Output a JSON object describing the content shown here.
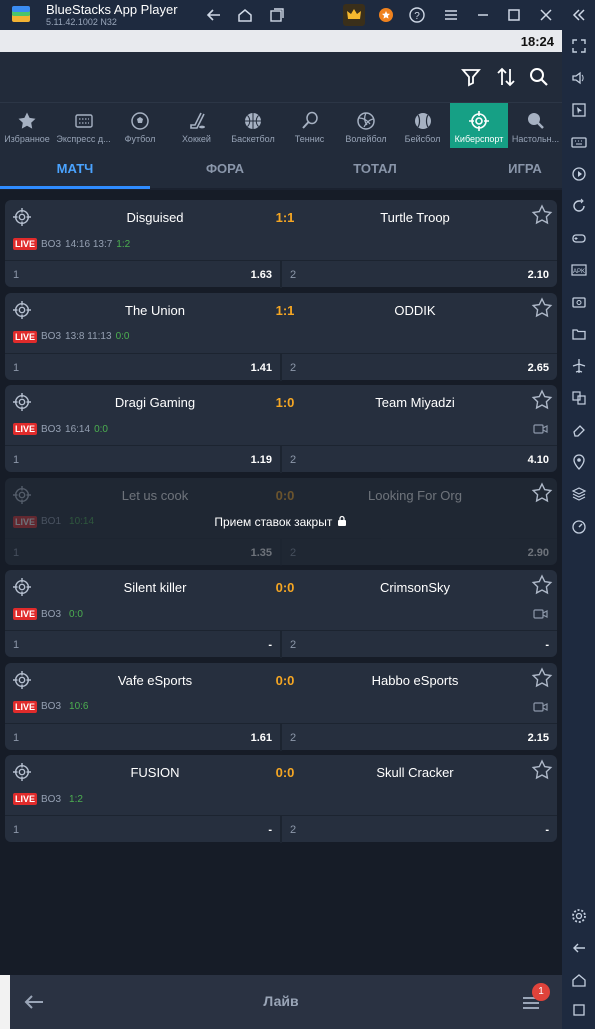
{
  "window": {
    "title": "BlueStacks App Player",
    "version": "5.11.42.1002 N32"
  },
  "status": {
    "time": "18:24"
  },
  "sports": [
    {
      "label": "Избранное",
      "icon": "star-icon"
    },
    {
      "label": "Экспресс д...",
      "icon": "express-icon"
    },
    {
      "label": "Футбол",
      "icon": "soccer-ball-icon"
    },
    {
      "label": "Хоккей",
      "icon": "hockey-stick-icon"
    },
    {
      "label": "Баскетбол",
      "icon": "basketball-icon"
    },
    {
      "label": "Теннис",
      "icon": "tennis-racket-icon"
    },
    {
      "label": "Волейбол",
      "icon": "volleyball-icon"
    },
    {
      "label": "Бейсбол",
      "icon": "baseball-icon"
    },
    {
      "label": "Киберспорт",
      "icon": "crosshair-icon",
      "active": true
    },
    {
      "label": "Настольн...",
      "icon": "table-tennis-icon"
    }
  ],
  "tabs": [
    "МАТЧ",
    "ФОРА",
    "ТОТАЛ",
    "ИГРА"
  ],
  "live_label": "LIVE",
  "matches": [
    {
      "team1": "Disguised",
      "team2": "Turtle Troop",
      "score": "1:1",
      "format": "BO3",
      "time": "14:16 13:7",
      "extra": "1:2",
      "odd1_label": "1",
      "odd1": "1.63",
      "odd2_label": "2",
      "odd2": "2.10",
      "video": false
    },
    {
      "team1": "The Union",
      "team2": "ODDIK",
      "score": "1:1",
      "format": "BO3",
      "time": "13:8 11:13",
      "extra": "0:0",
      "odd1_label": "1",
      "odd1": "1.41",
      "odd2_label": "2",
      "odd2": "2.65",
      "video": false
    },
    {
      "team1": "Dragi Gaming",
      "team2": "Team Miyadzi",
      "score": "1:0",
      "format": "BO3",
      "time": "16:14",
      "extra": "0:0",
      "odd1_label": "1",
      "odd1": "1.19",
      "odd2_label": "2",
      "odd2": "4.10",
      "video": true
    },
    {
      "team1": "Let us cook",
      "team2": "Looking For Org",
      "score": "0:0",
      "format": "BO1",
      "time": "",
      "extra": "10:14",
      "odd1_label": "1",
      "odd1": "1.35",
      "odd2_label": "2",
      "odd2": "2.90",
      "video": false,
      "closed": "Прием ставок закрыт"
    },
    {
      "team1": "Silent killer",
      "team2": "CrimsonSky",
      "score": "0:0",
      "format": "BO3",
      "time": "",
      "extra": "0:0",
      "odd1_label": "1",
      "odd1": "-",
      "odd2_label": "2",
      "odd2": "-",
      "video": true
    },
    {
      "team1": "Vafe eSports",
      "team2": "Habbo eSports",
      "score": "0:0",
      "format": "BO3",
      "time": "",
      "extra": "10:6",
      "odd1_label": "1",
      "odd1": "1.61",
      "odd2_label": "2",
      "odd2": "2.15",
      "video": true
    },
    {
      "team1": "FUSION",
      "team2": "Skull Cracker",
      "score": "0:0",
      "format": "BO3",
      "time": "",
      "extra": "1:2",
      "odd1_label": "1",
      "odd1": "-",
      "odd2_label": "2",
      "odd2": "-",
      "video": false
    }
  ],
  "bottom": {
    "title": "Лайв",
    "badge": "1"
  },
  "colors": {
    "accent": "#2f8cff",
    "active_sport": "#16a085",
    "score": "#f5a623",
    "live": "#e02b2b"
  }
}
